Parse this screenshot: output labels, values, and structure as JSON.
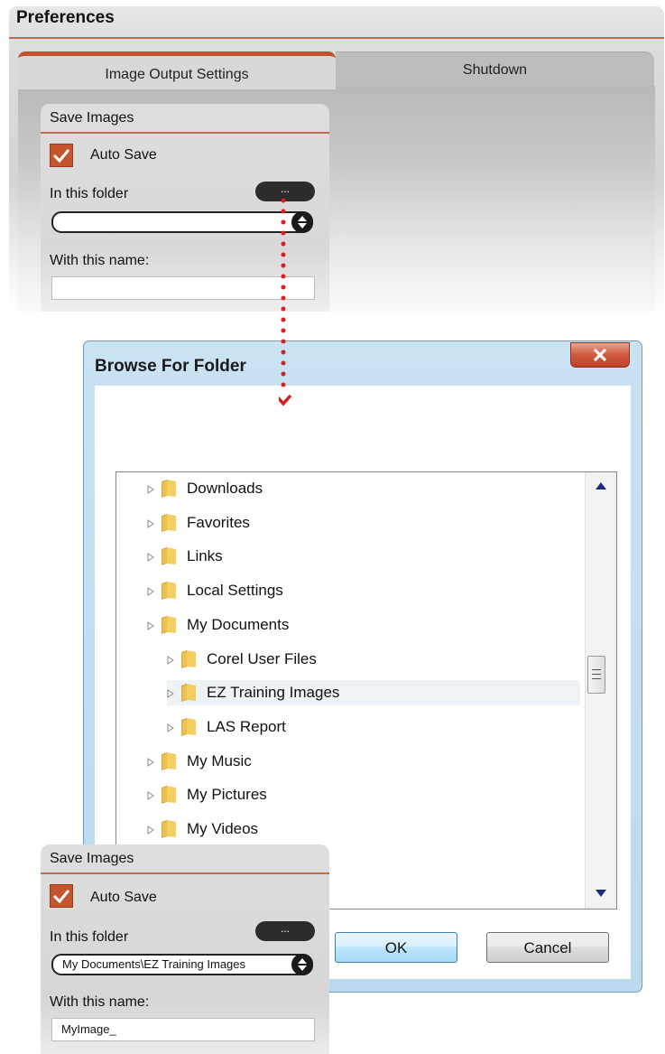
{
  "preferences": {
    "title": "Preferences",
    "tabs": [
      {
        "label": "Image Output Settings",
        "active": true
      },
      {
        "label": "Shutdown",
        "active": false
      }
    ],
    "save_images": {
      "title": "Save Images",
      "auto_save_label": "Auto Save",
      "auto_save_checked": true,
      "folder_label": "In this folder",
      "browse_label": "...",
      "folder_value": "",
      "name_label": "With this name:",
      "name_value": ""
    }
  },
  "dialog": {
    "title": "Browse For Folder",
    "close_icon": "close-x-icon",
    "tree": [
      {
        "label": "Downloads",
        "level": 0
      },
      {
        "label": "Favorites",
        "level": 0
      },
      {
        "label": "Links",
        "level": 0
      },
      {
        "label": "Local Settings",
        "level": 0
      },
      {
        "label": "My Documents",
        "level": 0
      },
      {
        "label": "Corel User Files",
        "level": 1
      },
      {
        "label": "EZ Training Images",
        "level": 1,
        "selected": true
      },
      {
        "label": "LAS Report",
        "level": 1
      },
      {
        "label": "My Music",
        "level": 0
      },
      {
        "label": "My Pictures",
        "level": 0
      },
      {
        "label": "My Videos",
        "level": 0
      }
    ],
    "ok_label": "OK",
    "cancel_label": "Cancel"
  },
  "save_images_result": {
    "title": "Save Images",
    "auto_save_label": "Auto Save",
    "auto_save_checked": true,
    "folder_label": "In this folder",
    "browse_label": "...",
    "folder_value": "My Documents\\EZ Training Images",
    "name_label": "With this name:",
    "name_value": "MyImage_"
  },
  "colors": {
    "accent": "#c4552c",
    "arrow": "#d62020",
    "dialog_frame": "#bcd9ee"
  }
}
